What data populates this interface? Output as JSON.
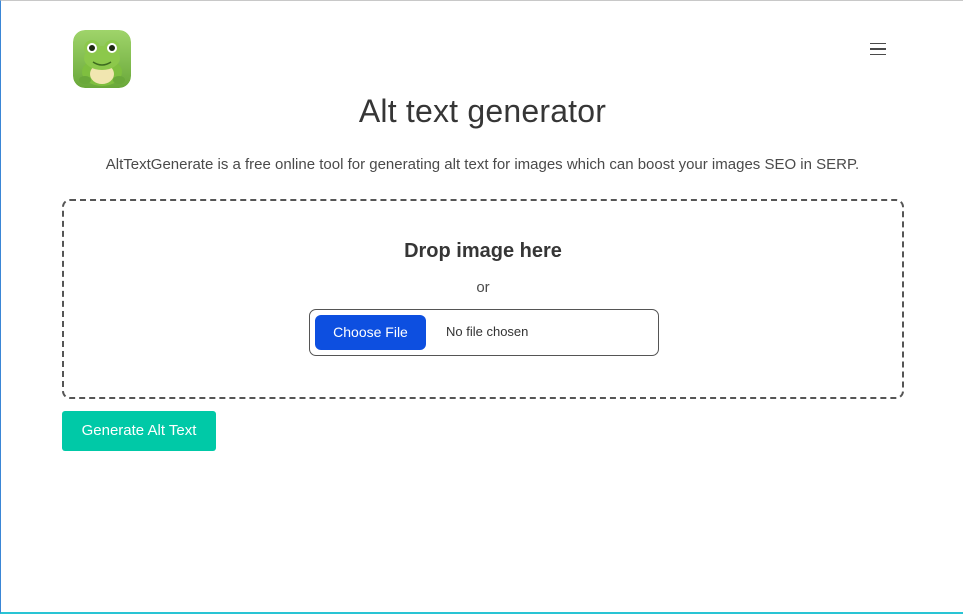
{
  "header": {
    "logo_icon": "frog-logo-icon",
    "menu_icon": "hamburger-menu-icon"
  },
  "main": {
    "title": "Alt text generator",
    "subtitle": "AltTextGenerate is a free online tool for generating alt text for images which can boost your images SEO in SERP."
  },
  "upload": {
    "drop_label": "Drop image here",
    "or_label": "or",
    "choose_file_label": "Choose File",
    "file_status": "No file chosen"
  },
  "actions": {
    "generate_label": "Generate Alt Text"
  },
  "colors": {
    "choose_button": "#0d4fe0",
    "generate_button": "#00c9a7",
    "text": "#363636"
  }
}
